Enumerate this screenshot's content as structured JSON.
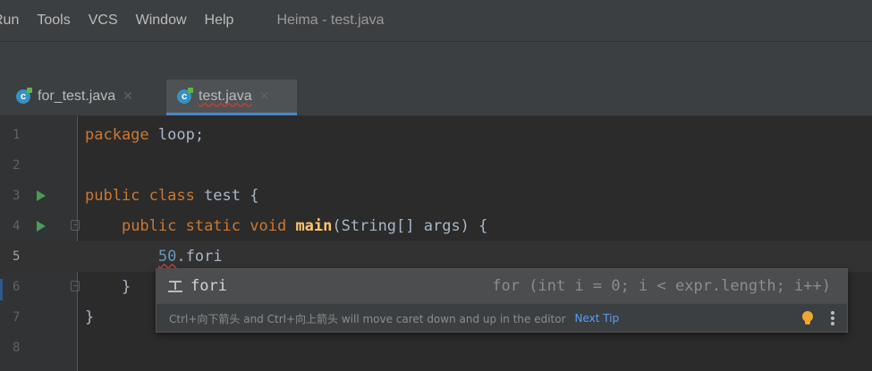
{
  "menu": {
    "items": [
      {
        "label": "Run"
      },
      {
        "label": "Tools"
      },
      {
        "label": "VCS"
      },
      {
        "label": "Window"
      },
      {
        "label": "Help"
      }
    ],
    "window_title": "Heima - test.java"
  },
  "tabs": [
    {
      "label": "for_test.java",
      "icon": "java-class-icon",
      "active": false
    },
    {
      "label": "test.java",
      "icon": "java-class-icon",
      "active": true
    }
  ],
  "editor": {
    "lines": [
      {
        "n": "1",
        "text": "package loop;"
      },
      {
        "n": "2",
        "text": ""
      },
      {
        "n": "3",
        "text": "public class test {",
        "run": true
      },
      {
        "n": "4",
        "text": "    public static void main(String[] args) {",
        "run": true
      },
      {
        "n": "5",
        "text": "        50.fori",
        "current": true
      },
      {
        "n": "6",
        "text": "    }"
      },
      {
        "n": "7",
        "text": "}"
      },
      {
        "n": "8",
        "text": ""
      }
    ]
  },
  "completion": {
    "item_name": "fori",
    "item_desc": "for (int i = 0; i < expr.length; i++)",
    "tip_text": "Ctrl+向下箭头 and Ctrl+向上箭头 will move caret down and up in the editor",
    "tip_link": "Next Tip"
  },
  "colors": {
    "keyword": "#cc7832",
    "method": "#ffc66d",
    "number": "#6897bb",
    "link": "#589df6",
    "run": "#499c54"
  }
}
